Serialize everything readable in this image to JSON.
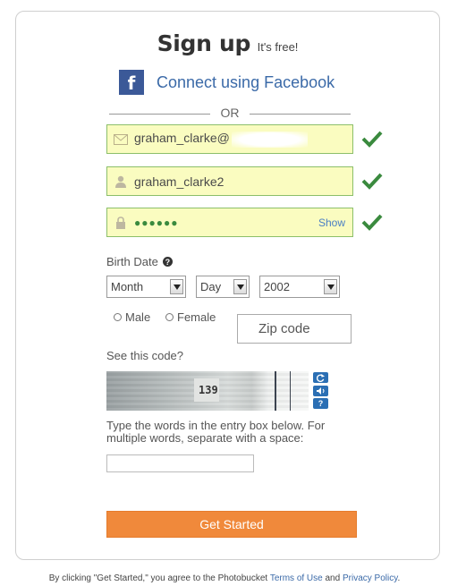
{
  "header": {
    "title": "Sign up",
    "subtitle": "It's free!"
  },
  "facebook": {
    "icon_letter": "f",
    "label": "Connect using Facebook"
  },
  "divider": {
    "label": "OR"
  },
  "email_field": {
    "icon": "envelope-icon",
    "value": "graham_clarke@",
    "valid": true
  },
  "username_field": {
    "icon": "user-icon",
    "value": "graham_clarke2",
    "valid": true
  },
  "password_field": {
    "icon": "lock-icon",
    "value": "●●●●●●",
    "toggle_label": "Show",
    "valid": true
  },
  "birth_date": {
    "label": "Birth Date",
    "month": "Month",
    "day": "Day",
    "year": "2002"
  },
  "gender": {
    "male_label": "Male",
    "female_label": "Female"
  },
  "zip": {
    "placeholder": "Zip code"
  },
  "captcha": {
    "prompt": "See this code?",
    "code_text": "139",
    "instructions": "Type the words in the entry box below. For multiple words, separate with a space:",
    "buttons": [
      "refresh-icon",
      "audio-icon",
      "help-icon"
    ]
  },
  "submit": {
    "label": "Get Started"
  },
  "footer": {
    "prefix": "By clicking \"Get Started,\" you agree to the Photobucket",
    "terms_label": "Terms of Use",
    "and": "and",
    "privacy_label": "Privacy Policy",
    "suffix": "."
  },
  "colors": {
    "accent": "#f0893b",
    "facebook": "#3b5998",
    "link": "#3b6aa8",
    "field_bg": "#fafcc0",
    "valid_check": "#3a8a3e"
  }
}
